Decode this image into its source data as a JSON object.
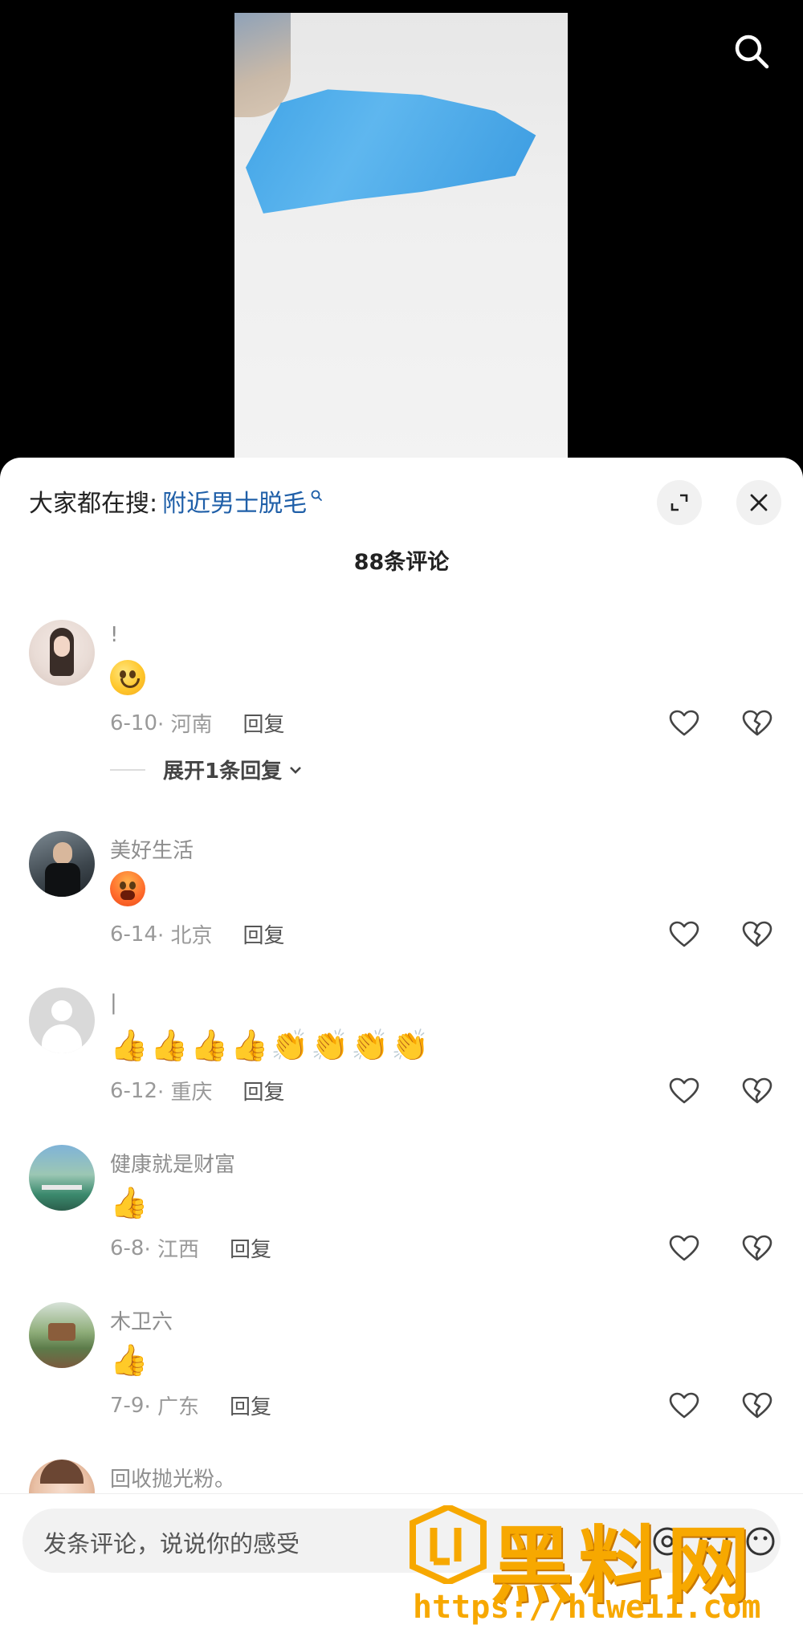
{
  "header": {
    "hot_search_prefix": "大家都在搜:",
    "hot_search_term": "附近男士脱毛",
    "comment_count": "88条评论"
  },
  "comments": [
    {
      "username": "!",
      "date": "6-10",
      "location": "· 河南",
      "reply": "回复",
      "expand": "展开1条回复",
      "emojis": [
        "grin"
      ]
    },
    {
      "username": "美好生活",
      "date": "6-14",
      "location": "· 北京",
      "reply": "回复",
      "emojis": [
        "angry"
      ]
    },
    {
      "username": "|",
      "date": "6-12",
      "location": "· 重庆",
      "reply": "回复",
      "emojis": [
        "thumbs-up",
        "thumbs-up",
        "thumbs-up",
        "thumbs-up",
        "clap",
        "clap",
        "clap",
        "clap"
      ]
    },
    {
      "username": "健康就是财富",
      "date": "6-8",
      "location": "· 江西",
      "reply": "回复",
      "emojis": [
        "thumbs-up"
      ]
    },
    {
      "username": "木卫六",
      "date": "7-9",
      "location": "· 广东",
      "reply": "回复",
      "emojis": [
        "thumbs-up"
      ]
    },
    {
      "username": "回收抛光粉。"
    }
  ],
  "input": {
    "placeholder": "发条评论，说说你的感受"
  },
  "watermark": {
    "brand": "黑料网",
    "url": "https://hlwe11.com"
  },
  "colors": {
    "accent_link": "#1f5fa8",
    "watermark": "#f7a800"
  }
}
